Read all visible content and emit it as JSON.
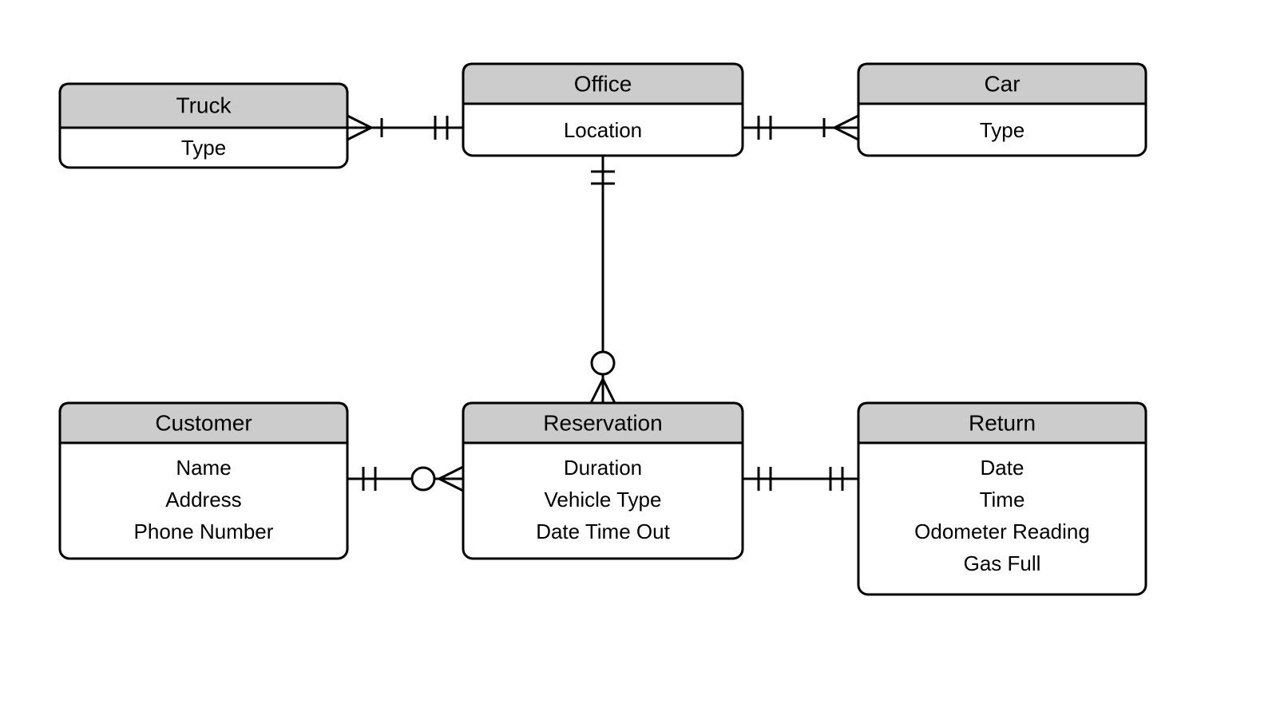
{
  "entities": {
    "truck": {
      "title": "Truck",
      "attrs": [
        "Type"
      ]
    },
    "office": {
      "title": "Office",
      "attrs": [
        "Location"
      ]
    },
    "car": {
      "title": "Car",
      "attrs": [
        "Type"
      ]
    },
    "customer": {
      "title": "Customer",
      "attrs": [
        "Name",
        "Address",
        "Phone Number"
      ]
    },
    "reservation": {
      "title": "Reservation",
      "attrs": [
        "Duration",
        "Vehicle Type",
        "Date Time Out"
      ]
    },
    "return": {
      "title": "Return",
      "attrs": [
        "Date",
        "Time",
        "Odometer Reading",
        "Gas Full"
      ]
    }
  }
}
